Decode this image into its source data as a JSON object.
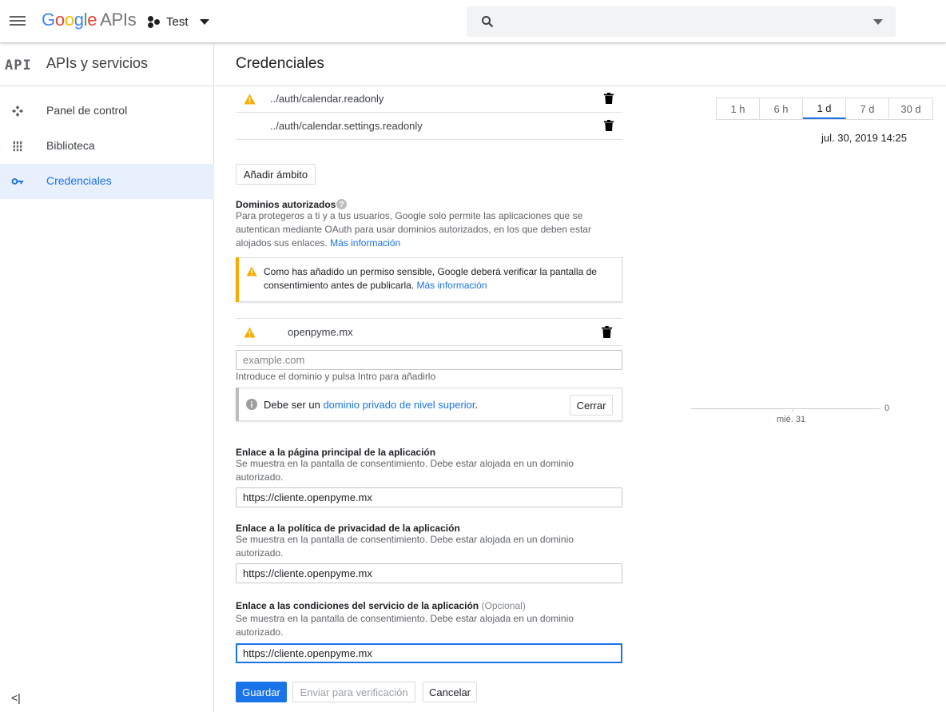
{
  "app": {
    "logo_google": "Google",
    "logo_apis": "APIs",
    "project_name": "Test"
  },
  "search": {
    "placeholder": ""
  },
  "sidebar": {
    "badge": "API",
    "title": "APIs y servicios",
    "items": [
      {
        "label": "Panel de control",
        "icon": "dashboard-icon"
      },
      {
        "label": "Biblioteca",
        "icon": "library-icon"
      },
      {
        "label": "Credenciales",
        "icon": "key-icon",
        "active": true
      }
    ],
    "collapse_label": "<|"
  },
  "page": {
    "title": "Credenciales"
  },
  "scopes": [
    {
      "text": "../auth/calendar.readonly",
      "warning": true
    },
    {
      "text": "../auth/calendar.settings.readonly",
      "warning": false
    }
  ],
  "add_scope_label": "Añadir ámbito",
  "authorized_domains": {
    "title": "Dominios autorizados",
    "help_line1": "Para protegeros a ti y a tus usuarios, Google solo permite las aplicaciones que se",
    "help_line2": "autentican mediante OAuth para usar dominios autorizados, en los que deben estar",
    "help_line3": "alojados sus enlaces.",
    "help_link": "Más información",
    "warning_line1": "Como has añadido un permiso sensible, Google deberá verificar la pantalla de",
    "warning_line2": "consentimiento antes de publicarla.",
    "warning_link": "Más información",
    "domain": "openpyme.mx",
    "input_placeholder": "example.com",
    "input_hint": "Introduce el dominio y pulsa Intro para añadirlo",
    "info_prefix": "Debe ser un",
    "info_link": "dominio privado de nivel superior",
    "info_suffix": ".",
    "close_label": "Cerrar"
  },
  "homepage": {
    "title": "Enlace a la página principal de la aplicación",
    "help_line1": "Se muestra en la pantalla de consentimiento. Debe estar alojada en un dominio",
    "help_line2": "autorizado.",
    "value": "https://cliente.openpyme.mx"
  },
  "privacy": {
    "title": "Enlace a la política de privacidad de la aplicación",
    "help_line1": "Se muestra en la pantalla de consentimiento. Debe estar alojada en un dominio",
    "help_line2": "autorizado.",
    "value": "https://cliente.openpyme.mx"
  },
  "terms": {
    "title": "Enlace a las condiciones del servicio de la aplicación",
    "optional": "(Opcional)",
    "help_line1": "Se muestra en la pantalla de consentimiento. Debe estar alojada en un dominio",
    "help_line2": "autorizado.",
    "value": "https://cliente.openpyme.mx"
  },
  "actions": {
    "save": "Guardar",
    "submit": "Enviar para verificación",
    "cancel": "Cancelar"
  },
  "right_panel": {
    "tabs": [
      "1 h",
      "6 h",
      "1 d",
      "7 d",
      "30 d"
    ],
    "active_tab": "1 d",
    "date": "jul. 30, 2019 14:25",
    "x_label": "mié. 31",
    "y_label": "0"
  },
  "colors": {
    "accent": "#1a73e8",
    "warning": "#f9ab00",
    "primary_button": "#1a73e8"
  }
}
